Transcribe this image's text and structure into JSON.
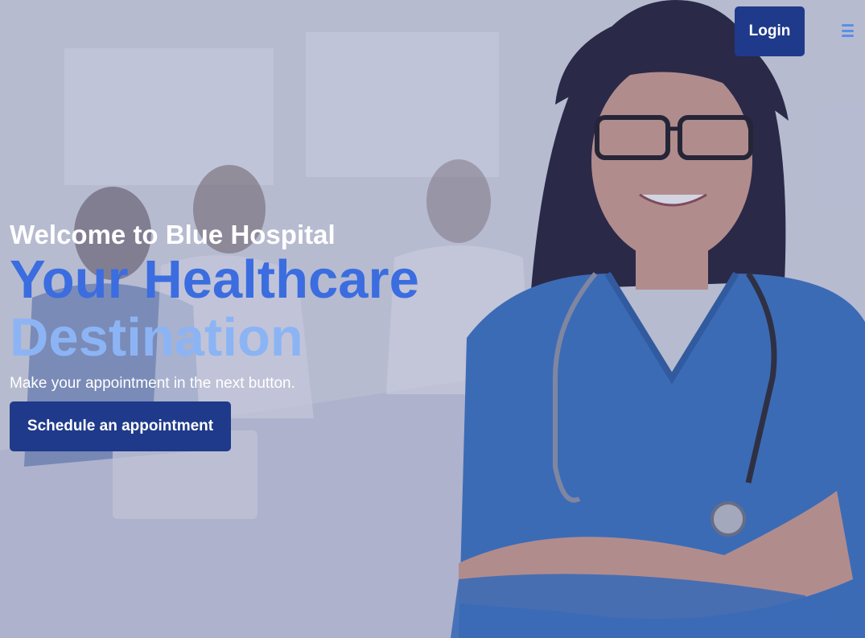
{
  "header": {
    "login_label": "Login",
    "menu_icon": "hamburger-menu-icon"
  },
  "hero": {
    "welcome": "Welcome to Blue Hospital",
    "tagline_line1": "Your Healthcare",
    "tagline_line2": "Destination",
    "subtitle": "Make your appointment in the next button.",
    "cta_label": "Schedule an appointment",
    "background_image": "doctor-with-stethoscope-photo"
  },
  "colors": {
    "button_bg": "#1f3a8a",
    "tagline_primary": "#3b6de0",
    "tagline_secondary": "#8cb4f5",
    "menu_icon": "#5b8fe6"
  }
}
